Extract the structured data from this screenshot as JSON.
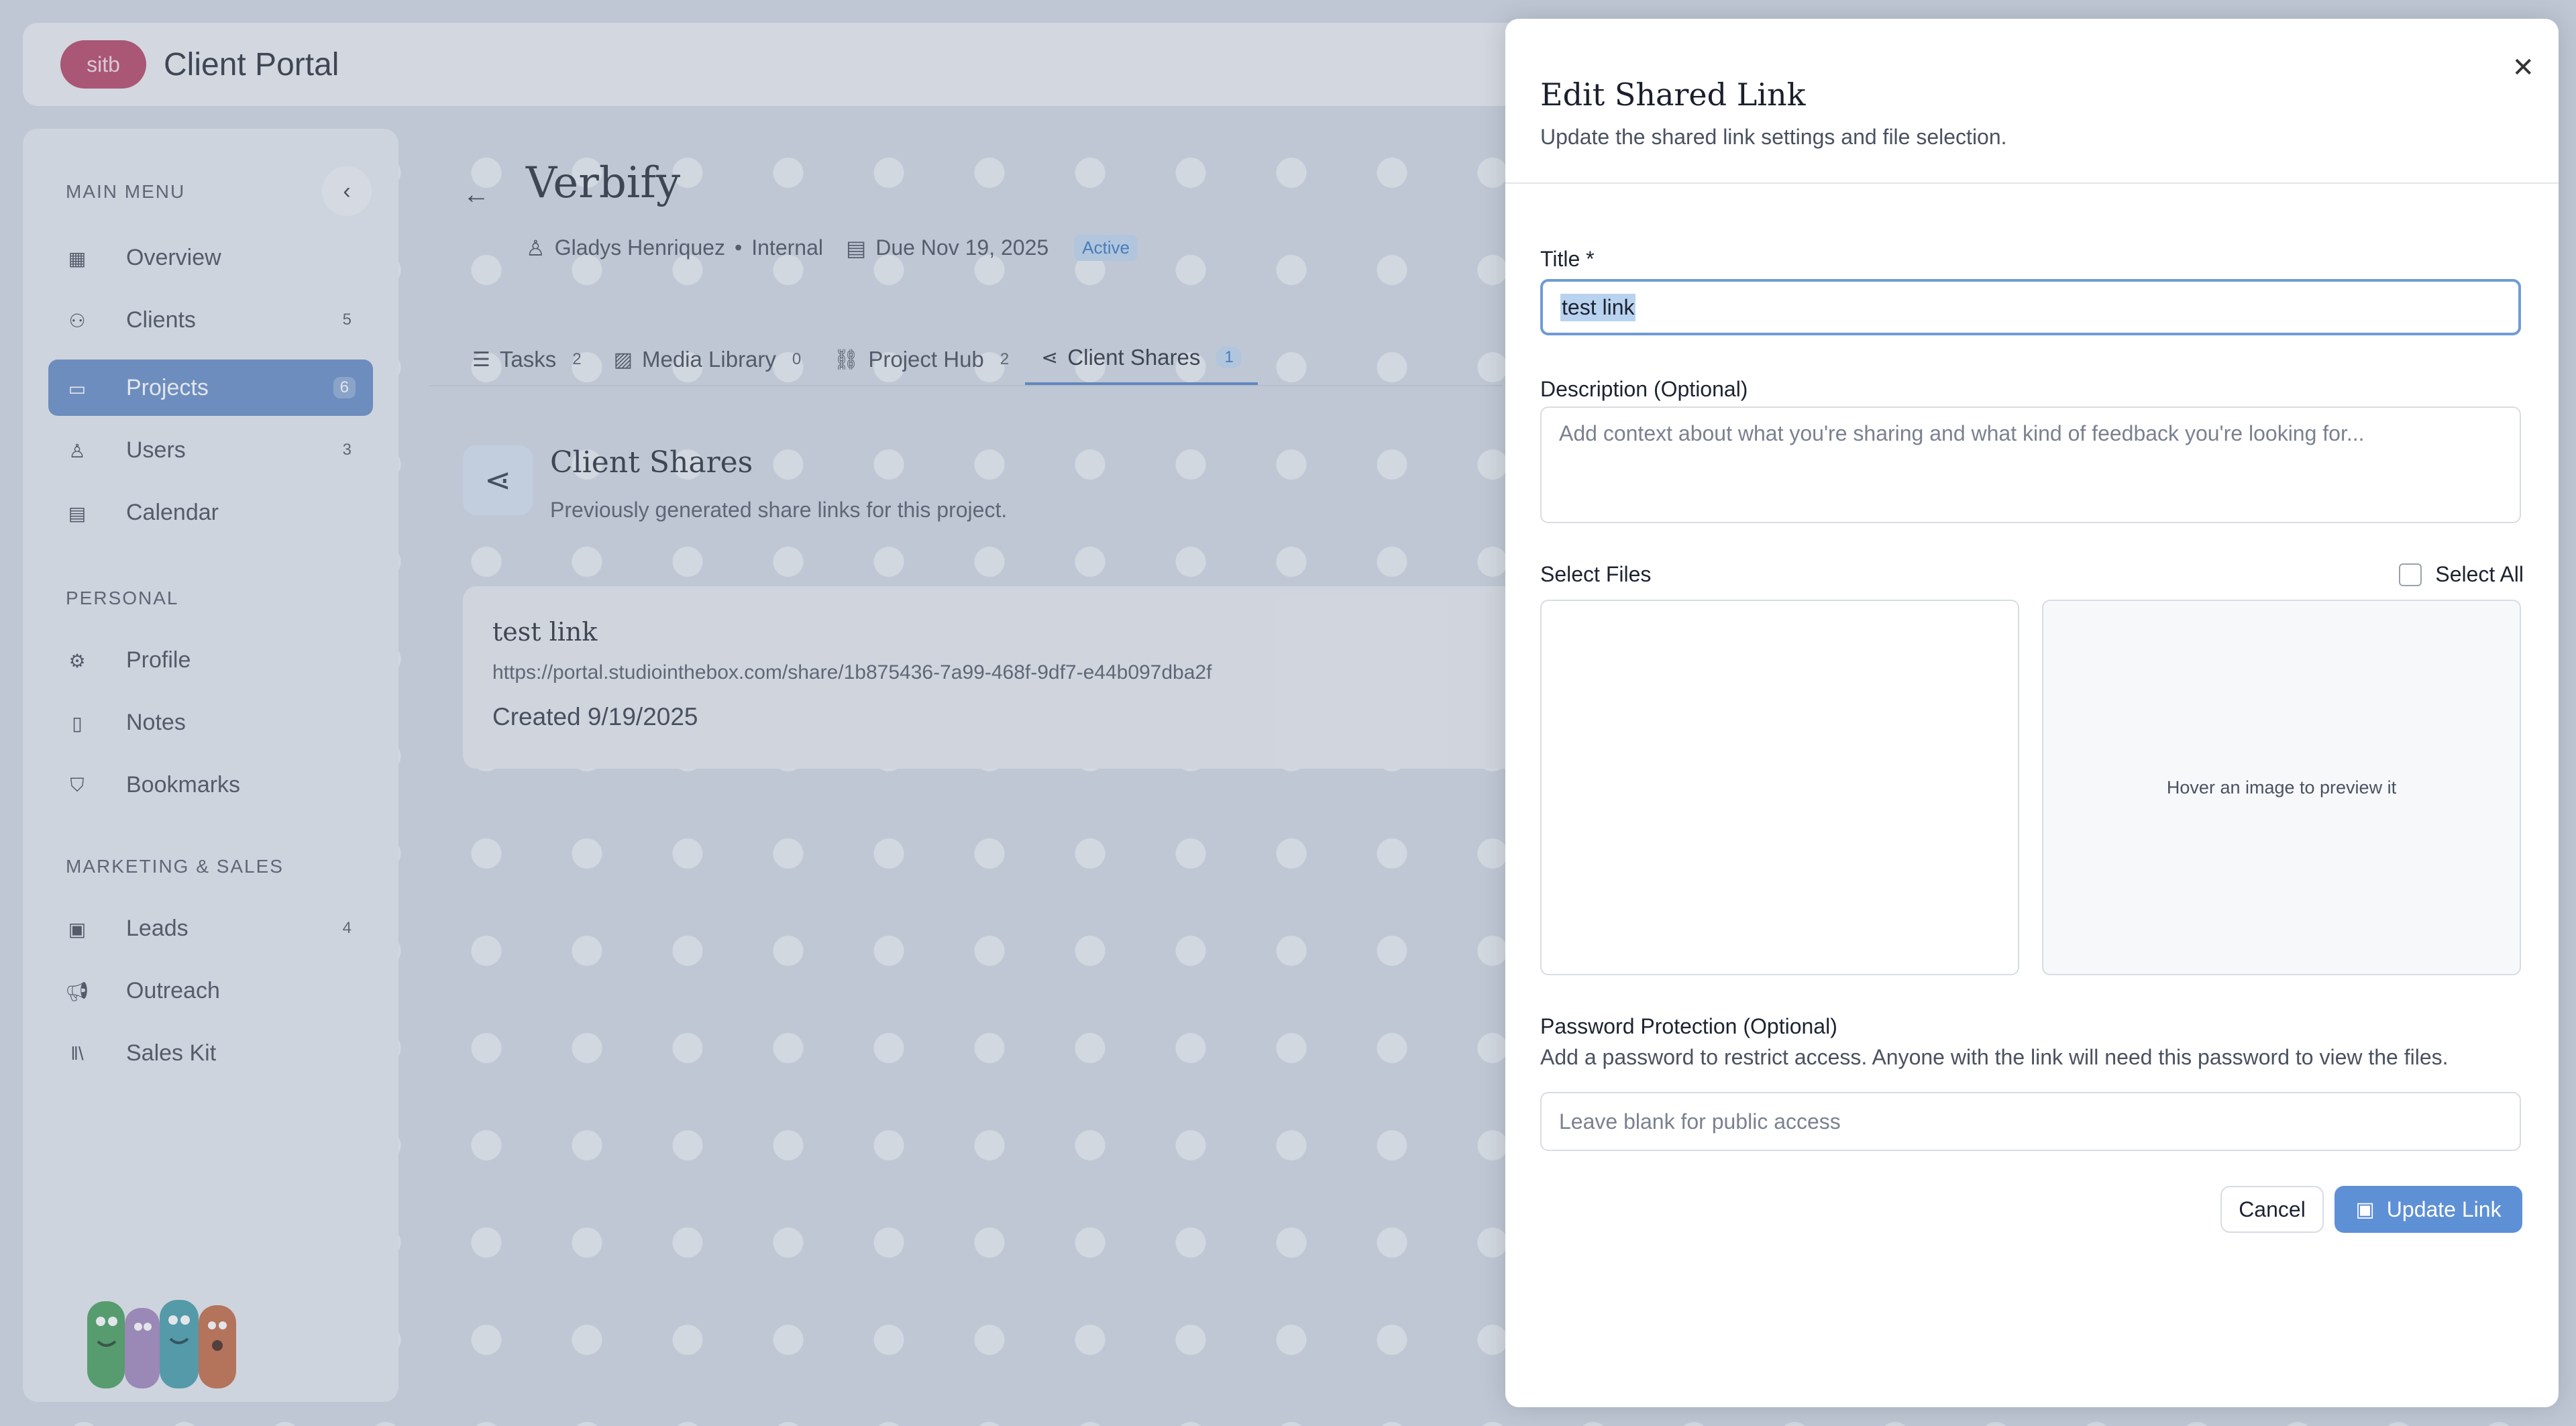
{
  "header": {
    "logo_text": "sitb",
    "app_title": "Client Portal"
  },
  "sidebar": {
    "sections": {
      "main": "MAIN MENU",
      "personal": "PERSONAL",
      "marketing": "MARKETING & SALES"
    },
    "items": [
      {
        "label": "Overview",
        "icon": "grid-icon",
        "count": ""
      },
      {
        "label": "Clients",
        "icon": "users-icon",
        "count": "5"
      },
      {
        "label": "Projects",
        "icon": "folder-icon",
        "count": "6"
      },
      {
        "label": "Users",
        "icon": "user-icon",
        "count": "3"
      },
      {
        "label": "Calendar",
        "icon": "calendar-icon",
        "count": ""
      },
      {
        "label": "Profile",
        "icon": "gear-icon",
        "count": ""
      },
      {
        "label": "Notes",
        "icon": "document-icon",
        "count": ""
      },
      {
        "label": "Bookmarks",
        "icon": "bookmark-icon",
        "count": ""
      },
      {
        "label": "Leads",
        "icon": "contact-icon",
        "count": "4"
      },
      {
        "label": "Outreach",
        "icon": "megaphone-icon",
        "count": ""
      },
      {
        "label": "Sales Kit",
        "icon": "library-icon",
        "count": ""
      }
    ]
  },
  "project": {
    "title": "Verbify",
    "owner": "Gladys Henriquez",
    "type": "Internal",
    "due": "Due Nov 19, 2025",
    "status": "Active"
  },
  "tabs": [
    {
      "label": "Tasks",
      "count": "2"
    },
    {
      "label": "Media Library",
      "count": "0"
    },
    {
      "label": "Project Hub",
      "count": "2"
    },
    {
      "label": "Client Shares",
      "count": "1"
    }
  ],
  "client_shares": {
    "title": "Client Shares",
    "subtitle": "Previously generated share links for this project.",
    "links": [
      {
        "title": "test link",
        "url": "https://portal.studiointhebox.com/share/1b875436-7a99-468f-9df7-e44b097dba2f",
        "created": "Created 9/19/2025"
      }
    ]
  },
  "modal": {
    "title": "Edit Shared Link",
    "subtitle": "Update the shared link settings and file selection.",
    "title_label": "Title *",
    "title_value": "test link",
    "description_label": "Description (Optional)",
    "description_placeholder": "Add context about what you're sharing and what kind of feedback you're looking for...",
    "select_files_label": "Select Files",
    "select_all_label": "Select All",
    "preview_hint": "Hover an image to preview it",
    "password_label": "Password Protection (Optional)",
    "password_help": "Add a password to restrict access. Anyone with the link will need this password to view the files.",
    "password_placeholder": "Leave blank for public access",
    "cancel_label": "Cancel",
    "update_label": "Update Link"
  }
}
